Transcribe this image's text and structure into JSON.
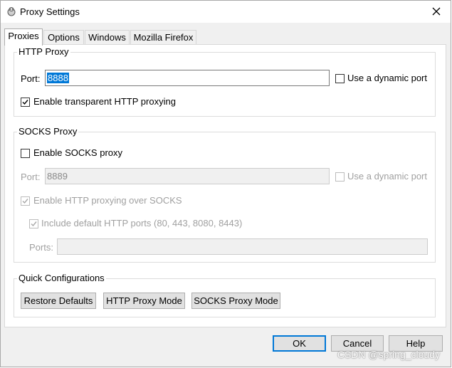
{
  "window": {
    "title": "Proxy Settings",
    "close_glyph": "✕"
  },
  "tabs": [
    {
      "label": "Proxies",
      "active": true
    },
    {
      "label": "Options",
      "active": false
    },
    {
      "label": "Windows",
      "active": false
    },
    {
      "label": "Mozilla Firefox",
      "active": false
    }
  ],
  "http_proxy": {
    "title": "HTTP Proxy",
    "port_label": "Port:",
    "port_value": "8888",
    "dynamic_port_label": "Use a dynamic port",
    "dynamic_port_checked": false,
    "transparent_label": "Enable transparent HTTP proxying",
    "transparent_checked": true
  },
  "socks_proxy": {
    "title": "SOCKS Proxy",
    "enable_label": "Enable SOCKS proxy",
    "enable_checked": false,
    "port_label": "Port:",
    "port_value": "8889",
    "dynamic_port_label": "Use a dynamic port",
    "dynamic_port_checked": false,
    "http_over_socks_label": "Enable HTTP proxying over SOCKS",
    "http_over_socks_checked": true,
    "include_ports_label": "Include default HTTP ports (80, 443, 8080, 8443)",
    "include_ports_checked": true,
    "ports_label": "Ports:",
    "ports_value": ""
  },
  "quick_config": {
    "title": "Quick Configurations",
    "restore_label": "Restore Defaults",
    "http_mode_label": "HTTP Proxy Mode",
    "socks_mode_label": "SOCKS Proxy Mode"
  },
  "footer": {
    "ok_label": "OK",
    "cancel_label": "Cancel",
    "help_label": "Help"
  },
  "watermark": "CSDN @spring_cloudy",
  "colors": {
    "accent": "#0078d7",
    "disabled_text": "#a0a0a0"
  }
}
